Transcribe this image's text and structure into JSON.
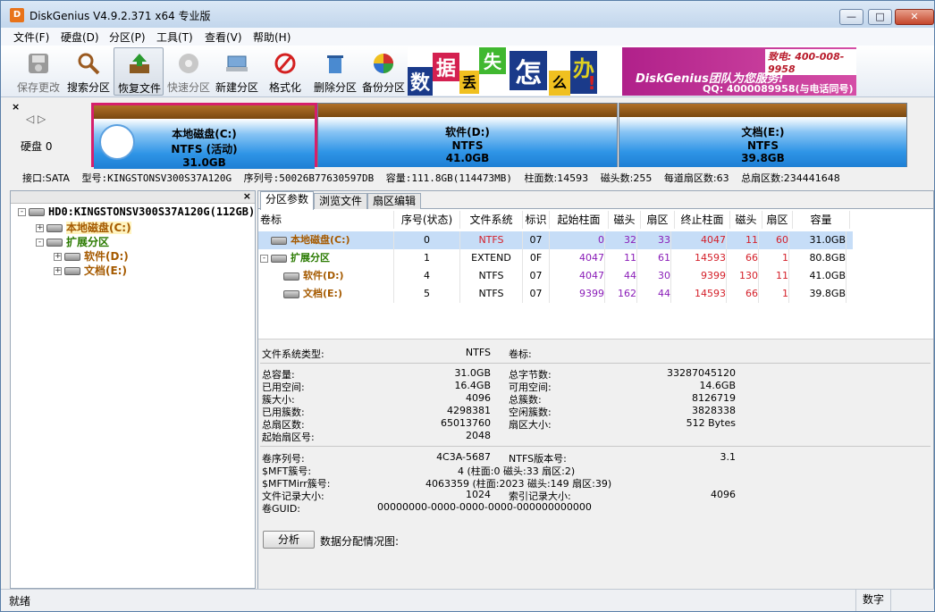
{
  "window": {
    "title": "DiskGenius V4.9.2.371 x64 专业版",
    "app_icon": "D"
  },
  "menu": [
    "文件(F)",
    "硬盘(D)",
    "分区(P)",
    "工具(T)",
    "查看(V)",
    "帮助(H)"
  ],
  "toolbar": [
    {
      "label": "保存更改",
      "icon": "save-icon",
      "disabled": true
    },
    {
      "label": "搜索分区",
      "icon": "search-icon",
      "disabled": false
    },
    {
      "label": "恢复文件",
      "icon": "restore-icon",
      "disabled": false,
      "active": true
    },
    {
      "label": "快速分区",
      "icon": "quick-partition-icon",
      "disabled": true
    },
    {
      "label": "新建分区",
      "icon": "new-partition-icon",
      "disabled": false
    },
    {
      "label": "格式化",
      "icon": "format-icon",
      "disabled": false
    },
    {
      "label": "删除分区",
      "icon": "delete-icon",
      "disabled": false
    },
    {
      "label": "备份分区",
      "icon": "backup-icon",
      "disabled": false
    }
  ],
  "banner": {
    "chars": [
      "数",
      "据",
      "丢",
      "失",
      "怎",
      "么",
      "办",
      "!"
    ],
    "slogan": "DiskGenius团队为您服务!",
    "phone": "致电: 400-008-9958",
    "qq": "QQ: 4000089958(与电话同号)"
  },
  "disk_map": {
    "disk_label": "硬盘 0",
    "partitions": [
      {
        "name": "本地磁盘(C:)",
        "fs": "NTFS (活动)",
        "size": "31.0GB"
      },
      {
        "name": "软件(D:)",
        "fs": "NTFS",
        "size": "41.0GB"
      },
      {
        "name": "文档(E:)",
        "fs": "NTFS",
        "size": "39.8GB"
      }
    ],
    "info": {
      "interface": "接口:SATA",
      "model": "型号:KINGSTONSV300S37A120G",
      "serial": "序列号:50026B77630597DB",
      "capacity": "容量:111.8GB(114473MB)",
      "cylinders": "柱面数:14593",
      "heads": "磁头数:255",
      "sectors_per_track": "每道扇区数:63",
      "total_sectors": "总扇区数:234441648"
    }
  },
  "tree": {
    "root": "HD0:KINGSTONSV300S37A120G(112GB)",
    "c": "本地磁盘(C:)",
    "ext": "扩展分区",
    "d": "软件(D:)",
    "e": "文档(E:)"
  },
  "tabs": [
    "分区参数",
    "浏览文件",
    "扇区编辑"
  ],
  "table": {
    "headers": [
      "卷标",
      "序号(状态)",
      "文件系统",
      "标识",
      "起始柱面",
      "磁头",
      "扇区",
      "终止柱面",
      "磁头",
      "扇区",
      "容量"
    ],
    "rows": [
      {
        "label": "本地磁盘(C:)",
        "index": "0",
        "fs": "NTFS",
        "id": "07",
        "start_cyl": "0",
        "start_head": "32",
        "start_sec": "33",
        "end_cyl": "4047",
        "end_head": "11",
        "end_sec": "60",
        "size": "31.0GB"
      },
      {
        "label": "扩展分区",
        "index": "1",
        "fs": "EXTEND",
        "id": "0F",
        "start_cyl": "4047",
        "start_head": "11",
        "start_sec": "61",
        "end_cyl": "14593",
        "end_head": "66",
        "end_sec": "1",
        "size": "80.8GB"
      },
      {
        "label": "软件(D:)",
        "index": "4",
        "fs": "NTFS",
        "id": "07",
        "start_cyl": "4047",
        "start_head": "44",
        "start_sec": "30",
        "end_cyl": "9399",
        "end_head": "130",
        "end_sec": "11",
        "size": "41.0GB"
      },
      {
        "label": "文档(E:)",
        "index": "5",
        "fs": "NTFS",
        "id": "07",
        "start_cyl": "9399",
        "start_head": "162",
        "start_sec": "44",
        "end_cyl": "14593",
        "end_head": "66",
        "end_sec": "1",
        "size": "39.8GB"
      }
    ]
  },
  "details": {
    "fs_type_label": "文件系统类型:",
    "fs_type": "NTFS",
    "volume_label": "卷标:",
    "total_cap_label": "总容量:",
    "total_cap": "31.0GB",
    "used_label": "已用空间:",
    "used": "16.4GB",
    "cluster_size_label": "簇大小:",
    "cluster_size": "4096",
    "used_clusters_label": "已用簇数:",
    "used_clusters": "4298381",
    "total_sectors_label": "总扇区数:",
    "total_sectors": "65013760",
    "start_sector_label": "起始扇区号:",
    "start_sector": "2048",
    "total_bytes_label": "总字节数:",
    "total_bytes": "33287045120",
    "free_label": "可用空间:",
    "free": "14.6GB",
    "total_clusters_label": "总簇数:",
    "total_clusters": "8126719",
    "free_clusters_label": "空闲簇数:",
    "free_clusters": "3828338",
    "sector_size_label": "扇区大小:",
    "sector_size": "512 Bytes",
    "serial_label": "卷序列号:",
    "serial": "4C3A-5687",
    "ntfs_ver_label": "NTFS版本号:",
    "ntfs_ver": "3.1",
    "mft_label": "$MFT簇号:",
    "mft": "4 (柱面:0 磁头:33 扇区:2)",
    "mftmirr_label": "$MFTMirr簇号:",
    "mftmirr": "4063359 (柱面:2023 磁头:149 扇区:39)",
    "record_size_label": "文件记录大小:",
    "record_size": "1024",
    "index_size_label": "索引记录大小:",
    "index_size": "4096",
    "guid_label": "卷GUID:",
    "guid": "00000000-0000-0000-0000-000000000000",
    "analyze_button": "分析",
    "distribution_label": "数据分配情况图:"
  },
  "status": {
    "left": "就绪",
    "right": "数字"
  }
}
